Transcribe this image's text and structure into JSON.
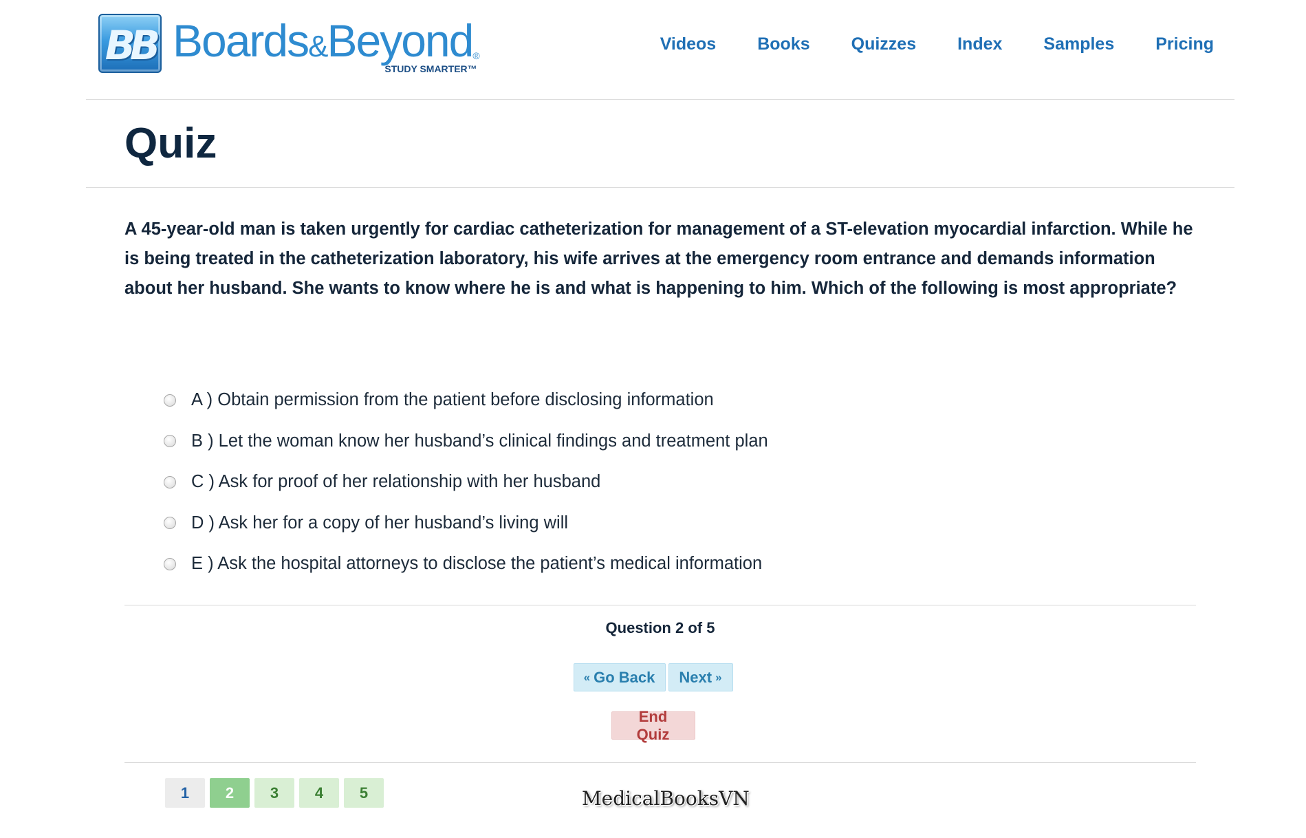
{
  "brand": {
    "logo_mark": "BB",
    "name_part1": "Boards",
    "name_amp": "&",
    "name_part2": "Beyond",
    "registered": "®",
    "tagline": "STUDY SMARTER™"
  },
  "nav": {
    "items": [
      "Videos",
      "Books",
      "Quizzes",
      "Index",
      "Samples",
      "Pricing"
    ]
  },
  "page": {
    "title": "Quiz"
  },
  "question": {
    "text": "A 45-year-old man is taken urgently for cardiac catheterization for management of a ST-elevation myocardial infarction. While he is being treated in the catheterization laboratory, his wife arrives at the emergency room entrance and demands information about her husband. She wants to know where he is and what is happening to him. Which of the following is most appropriate?"
  },
  "answers": [
    "A ) Obtain permission from the patient before disclosing information",
    "B ) Let the woman know her husband’s clinical findings and treatment plan",
    "C ) Ask for proof of her relationship with her husband",
    "D ) Ask her for a copy of her husband’s living will",
    "E ) Ask the hospital attorneys to disclose the patient’s medical information"
  ],
  "progress": {
    "text": "Question 2 of 5"
  },
  "buttons": {
    "back_prefix": "«",
    "back_label": "Go Back",
    "next_label": "Next",
    "next_suffix": "»",
    "end_label": "End Quiz"
  },
  "pager": {
    "pages": [
      "1",
      "2",
      "3",
      "4",
      "5"
    ],
    "current": "2"
  },
  "watermark": "MedicalBooksVN",
  "colors": {
    "brand_blue": "#2e8bd0",
    "nav_blue": "#1f6fb5",
    "title_navy": "#0f2740",
    "info_bg": "#d3ecf6",
    "danger_bg": "#f3d7d7",
    "danger_text": "#b23c3c",
    "active_page": "#8fcf8f"
  }
}
